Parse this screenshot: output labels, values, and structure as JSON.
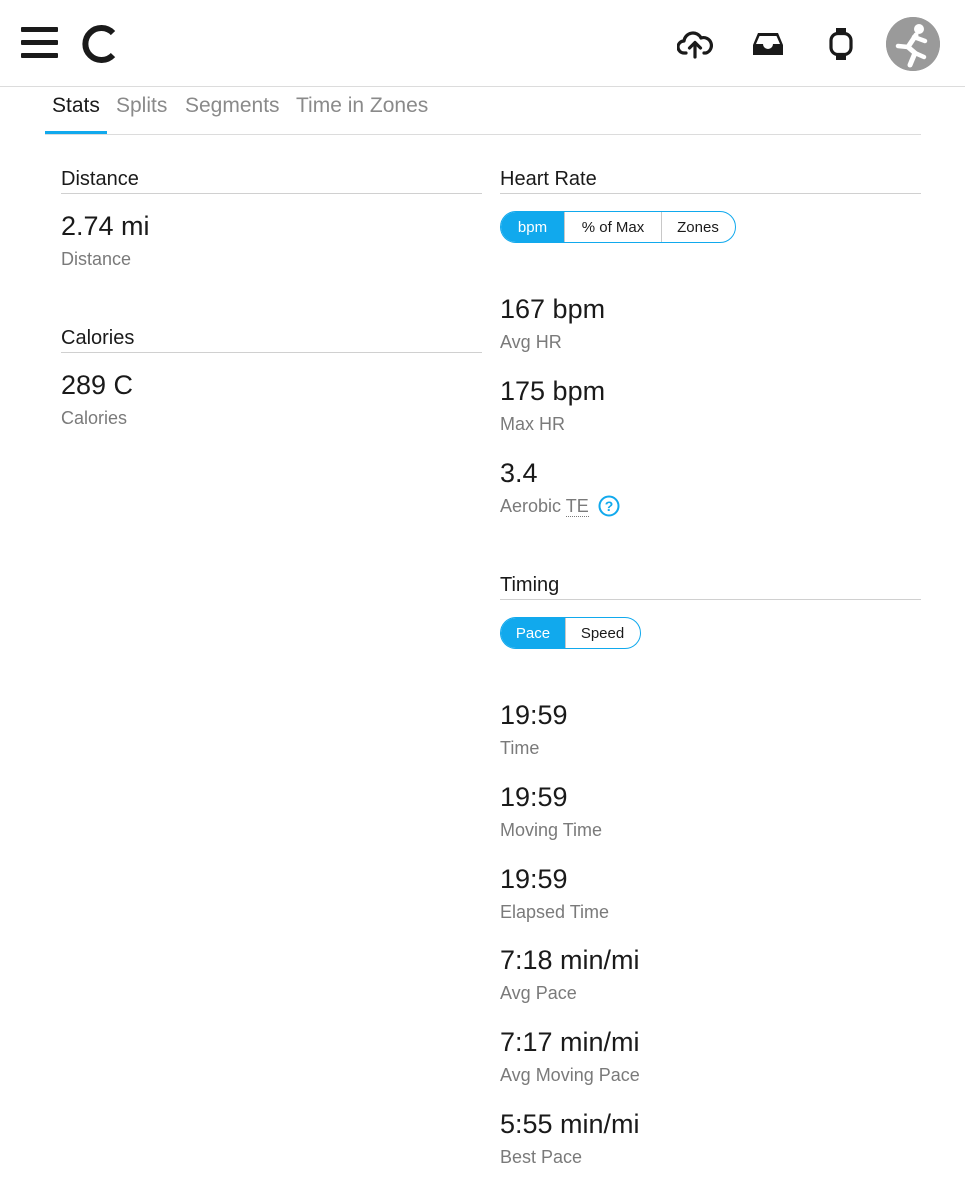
{
  "header": {
    "icons": [
      "menu-icon",
      "logo-icon",
      "upload-cloud-icon",
      "inbox-icon",
      "watch-icon",
      "avatar-icon"
    ]
  },
  "tabs": [
    {
      "label": "Stats",
      "active": true
    },
    {
      "label": "Splits",
      "active": false
    },
    {
      "label": "Segments",
      "active": false
    },
    {
      "label": "Time in Zones",
      "active": false
    }
  ],
  "distance": {
    "title": "Distance",
    "value": "2.74 mi",
    "label": "Distance"
  },
  "calories": {
    "title": "Calories",
    "value": "289 C",
    "label": "Calories"
  },
  "heart_rate": {
    "title": "Heart Rate",
    "toggle": [
      "bpm",
      "% of Max",
      "Zones"
    ],
    "selected": "bpm",
    "stats": [
      {
        "value": "167 bpm",
        "label": "Avg HR"
      },
      {
        "value": "175 bpm",
        "label": "Max HR"
      },
      {
        "value": "3.4",
        "label_prefix": "Aerobic ",
        "label_abbr": "TE"
      }
    ]
  },
  "timing": {
    "title": "Timing",
    "toggle": [
      "Pace",
      "Speed"
    ],
    "selected": "Pace",
    "stats": [
      {
        "value": "19:59",
        "label": "Time"
      },
      {
        "value": "19:59",
        "label": "Moving Time"
      },
      {
        "value": "19:59",
        "label": "Elapsed Time"
      },
      {
        "value": "7:18 min/mi",
        "label": "Avg Pace"
      },
      {
        "value": "7:17 min/mi",
        "label": "Avg Moving Pace"
      },
      {
        "value": "5:55 min/mi",
        "label": "Best Pace"
      }
    ]
  },
  "colors": {
    "accent": "#11a9ed",
    "text": "#1a1a1a",
    "muted": "#7a7a7a",
    "divider": "#dcdcdc"
  }
}
